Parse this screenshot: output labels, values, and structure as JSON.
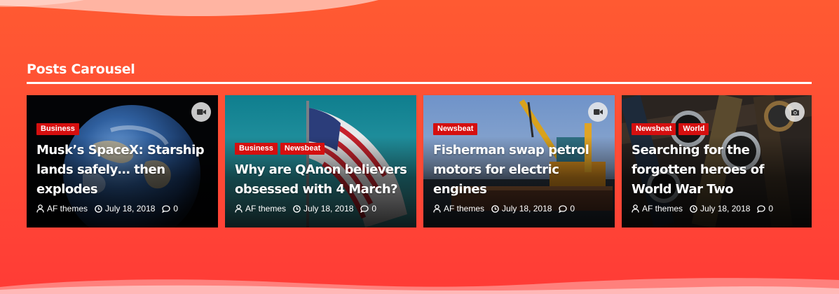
{
  "section": {
    "title": "Posts Carousel"
  },
  "colors": {
    "background": "#ff5033",
    "tag": "#d50f0f",
    "text": "#ffffff"
  },
  "cards": [
    {
      "tags": [
        "Business"
      ],
      "title": "Musk’s SpaceX: Starship lands safely… then explodes",
      "media": "video-icon",
      "author": "AF themes",
      "date": "July 18, 2018",
      "comments": "0"
    },
    {
      "tags": [
        "Business",
        "Newsbeat"
      ],
      "title": "Why are QAnon believers obsessed with 4 March?",
      "media": "",
      "author": "AF themes",
      "date": "July 18, 2018",
      "comments": "0"
    },
    {
      "tags": [
        "Newsbeat"
      ],
      "title": "Fisherman swap petrol motors for electric engines",
      "media": "video-icon",
      "author": "AF themes",
      "date": "July 18, 2018",
      "comments": "0"
    },
    {
      "tags": [
        "Newsbeat",
        "World"
      ],
      "title": "Searching for the forgotten heroes of World War Two",
      "media": "camera-icon",
      "author": "AF themes",
      "date": "July 18, 2018",
      "comments": "0"
    }
  ]
}
